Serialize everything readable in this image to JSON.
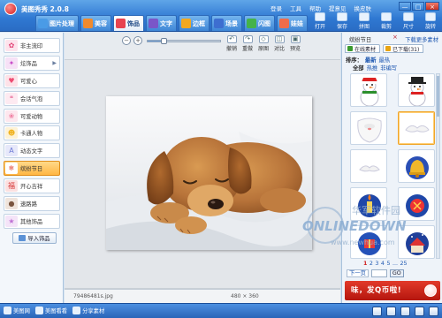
{
  "app": {
    "title": "美图秀秀 2.0.8",
    "top_menu": [
      "登录",
      "工具",
      "帮助",
      "提意见",
      "换皮肤"
    ],
    "window_buttons": [
      "—",
      "□",
      "×"
    ]
  },
  "tabs": [
    {
      "label": "图片处理",
      "icon": "picture-icon",
      "color": "#4a9be6",
      "active": false
    },
    {
      "label": "美容",
      "icon": "face-icon",
      "color": "#f08a2c",
      "active": false
    },
    {
      "label": "饰品",
      "icon": "heart-icon",
      "color": "#e8434f",
      "active": true
    },
    {
      "label": "文字",
      "icon": "text-icon",
      "color": "#7a56c8",
      "active": false
    },
    {
      "label": "边框",
      "icon": "frame-icon",
      "color": "#f2a820",
      "active": false
    },
    {
      "label": "场景",
      "icon": "scene-icon",
      "color": "#3d6ed0",
      "active": false
    },
    {
      "label": "闪图",
      "icon": "flash-icon",
      "color": "#45b34a",
      "active": false
    },
    {
      "label": "娃娃",
      "icon": "doll-icon",
      "color": "#ef6c4a",
      "active": false
    }
  ],
  "top_tools": [
    "打开",
    "保存",
    "拼图",
    "裁剪",
    "尺寸",
    "旋转"
  ],
  "left_panel": {
    "items": [
      {
        "label": "非主流印",
        "icon": "stamp-icon",
        "color": "#e3487a",
        "has_submenu": false,
        "active": false
      },
      {
        "label": "炫饰品",
        "icon": "sparkle-icon",
        "color": "#c94dc9",
        "has_submenu": true,
        "active": false
      },
      {
        "label": "可爱心",
        "icon": "heart-icon",
        "color": "#ef4c72",
        "has_submenu": false,
        "active": false
      },
      {
        "label": "会话气泡",
        "icon": "bubble-icon",
        "color": "#f6a5c0",
        "has_submenu": false,
        "active": false
      },
      {
        "label": "可爱动物",
        "icon": "animal-icon",
        "color": "#f07fa3",
        "has_submenu": false,
        "active": false
      },
      {
        "label": "卡通人物",
        "icon": "cartoon-icon",
        "color": "#f0b21e",
        "has_submenu": false,
        "active": false
      },
      {
        "label": "动态文字",
        "icon": "text-icon",
        "color": "#6f7ad6",
        "has_submenu": false,
        "active": false
      },
      {
        "label": "缤纷节日",
        "icon": "festival-icon",
        "color": "#e24b3f",
        "has_submenu": false,
        "active": true
      },
      {
        "label": "开心吉祥",
        "icon": "lucky-icon",
        "color": "#d73a3a",
        "has_submenu": false,
        "active": false
      },
      {
        "label": "速路路",
        "icon": "road-icon",
        "color": "#7a5540",
        "has_submenu": false,
        "active": false
      },
      {
        "label": "其他饰品",
        "icon": "misc-icon",
        "color": "#bf6fd3",
        "has_submenu": false,
        "active": false
      }
    ],
    "import_label": "导入饰品"
  },
  "canvas": {
    "zoom_minus": "−",
    "zoom_plus": "+",
    "zoom_level": 0.22,
    "edit_tools": [
      "撤销",
      "重做",
      "原图",
      "对比",
      "预览"
    ],
    "filename": "79486481s.jpg",
    "image_size": "480 × 360"
  },
  "right_panel": {
    "category": "缤纷节日",
    "more_downloads": "下载更多素材",
    "subtabs": [
      "在线素材",
      "已下载(31)"
    ],
    "sort_label": "排序：",
    "sort_options": [
      "最新",
      "最热"
    ],
    "filter_options": [
      "全部",
      "热推",
      "非编写"
    ],
    "pager_numbers": [
      "1",
      "2",
      "3",
      "4",
      "5",
      "...",
      "25"
    ],
    "pager_current": "1",
    "next_label": "下一页",
    "page_input": "",
    "go_label": "GO",
    "banner_text": "味，发Q币啦!"
  },
  "bottombar": {
    "links": [
      "美图网",
      "美图看看",
      "分享素材"
    ]
  },
  "watermark": {
    "line1": "华军软件园",
    "line2": "ONLINEDOWN",
    "line3": "www.newhua.com"
  }
}
